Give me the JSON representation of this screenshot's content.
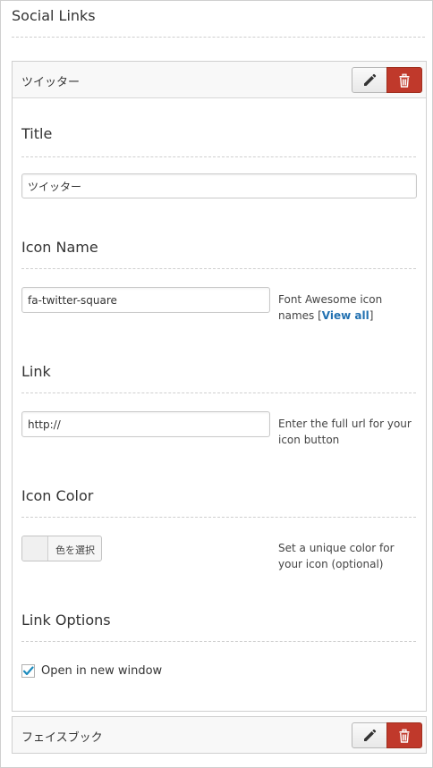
{
  "page": {
    "title": "Social Links"
  },
  "widgets": [
    {
      "header_title": "ツイッター",
      "fields": {
        "title": {
          "label": "Title",
          "value": "ツイッター"
        },
        "icon_name": {
          "label": "Icon Name",
          "value": "fa-twitter-square",
          "help_prefix": "Font Awesome icon names [",
          "help_link": "View all",
          "help_suffix": "]"
        },
        "link": {
          "label": "Link",
          "value": "http://",
          "help": "Enter the full url for your icon button"
        },
        "icon_color": {
          "label": "Icon Color",
          "button_text": "色を選択",
          "help": "Set a unique color for your icon (optional)"
        },
        "link_options": {
          "label": "Link Options",
          "checkbox_label": "Open in new window",
          "checked": true
        }
      }
    },
    {
      "header_title": "フェイスブック"
    }
  ],
  "icons": {
    "edit": "pencil-icon",
    "delete": "trash-icon",
    "check": "check-icon"
  },
  "colors": {
    "delete_button": "#c0392b",
    "link": "#2271b1",
    "checkbox_check": "#1e8cbe"
  }
}
